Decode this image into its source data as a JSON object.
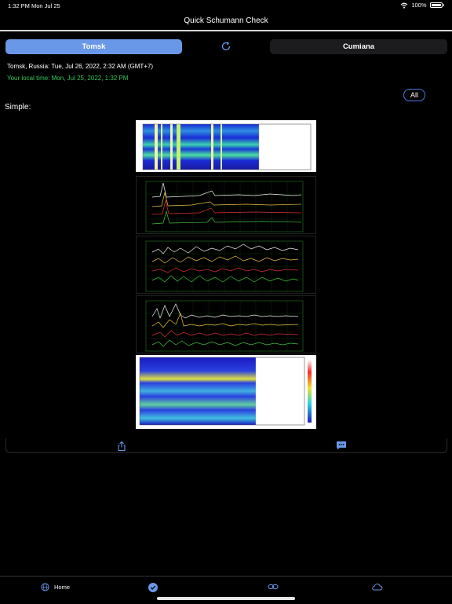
{
  "status_bar": {
    "time": "1:32 PM",
    "date": "Mon Jul 25",
    "battery": "100%"
  },
  "nav": {
    "title": "Quick Schumann Check"
  },
  "segments": {
    "left": "Tomsk",
    "right": "Cumiana",
    "refresh_icon": "refresh-icon"
  },
  "info": {
    "location_time": "Tomsk, Russia: Tue, Jul 26, 2022, 2:32 AM (GMT+7)",
    "local_time": "Your local time: Mon, Jul 25, 2022, 1:32 PM"
  },
  "filter": {
    "all_label": "All"
  },
  "section": {
    "label": "Simple:"
  },
  "colors": {
    "accent": "#6a98e8",
    "green": "#34c759"
  },
  "toolbar": {
    "share_icon": "share-icon",
    "message_icon": "message-icon"
  },
  "tabbar": {
    "home_label": "Home",
    "items": [
      "globe-icon",
      "checkmark-icon",
      "link-icon",
      "cloud-icon"
    ]
  }
}
